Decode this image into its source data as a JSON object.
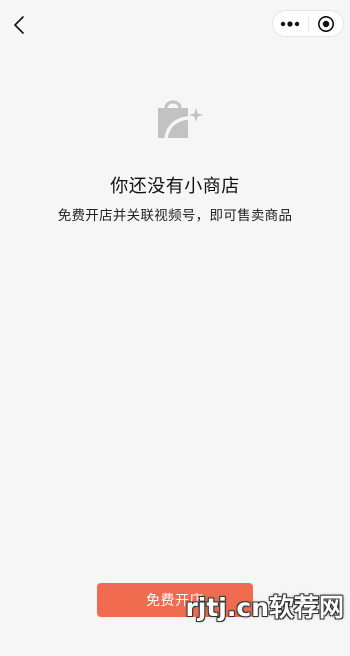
{
  "nav": {
    "back_icon": "chevron-left-icon",
    "more_icon": "more-dots-icon",
    "close_icon": "target-close-icon"
  },
  "empty_state": {
    "icon": "shopping-bag-sparkle-icon",
    "title": "你还没有小商店",
    "subtitle": "免费开店并关联视频号，即可售卖商品"
  },
  "actions": {
    "open_store_label": "免费开店"
  },
  "watermark": {
    "text": "rjtj.cn软荐网"
  },
  "colors": {
    "background": "#f6f6f6",
    "button": "#f06b4f",
    "icon_gray": "#bdbdbd"
  }
}
